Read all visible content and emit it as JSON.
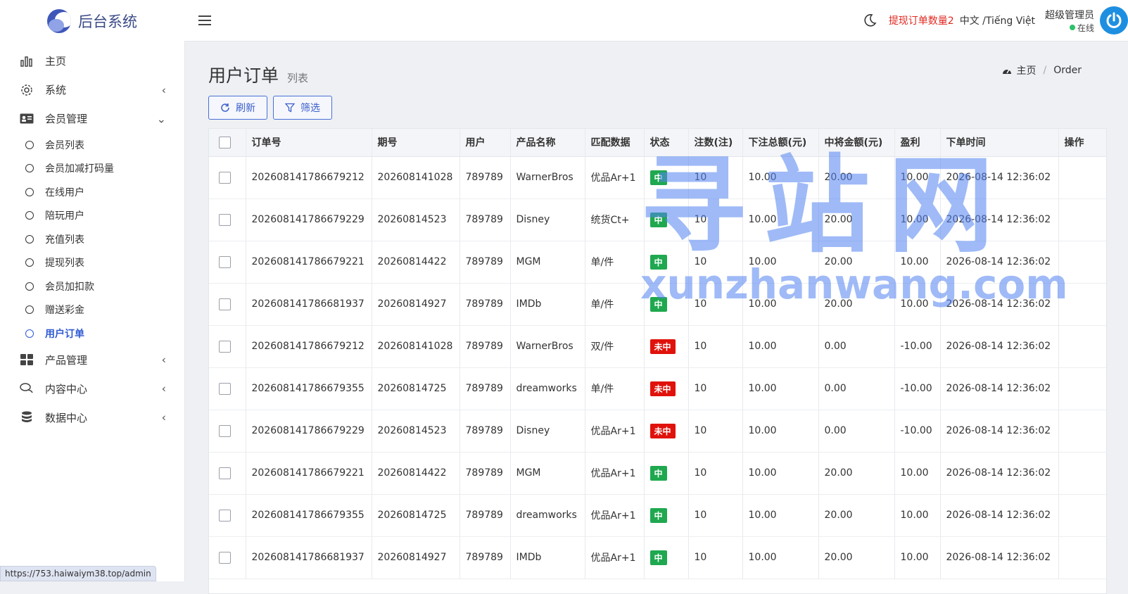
{
  "brand": {
    "name": "后台系统"
  },
  "sidebar": {
    "items": [
      {
        "label": "主页",
        "icon": "bar-chart-icon",
        "caret": ""
      },
      {
        "label": "系统",
        "icon": "gear-icon",
        "caret": "‹"
      },
      {
        "label": "会员管理",
        "icon": "id-card-icon",
        "caret": "⌄"
      }
    ],
    "member_sub": [
      {
        "label": "会员列表",
        "active": false
      },
      {
        "label": "会员加减打码量",
        "active": false
      },
      {
        "label": "在线用户",
        "active": false
      },
      {
        "label": "陪玩用户",
        "active": false
      },
      {
        "label": "充值列表",
        "active": false
      },
      {
        "label": "提现列表",
        "active": false
      },
      {
        "label": "会员加扣款",
        "active": false
      },
      {
        "label": "赠送彩金",
        "active": false
      },
      {
        "label": "用户订单",
        "active": true
      }
    ],
    "items_after": [
      {
        "label": "产品管理",
        "icon": "grid-icon",
        "caret": "‹"
      },
      {
        "label": "内容中心",
        "icon": "chat-icon",
        "caret": "‹"
      },
      {
        "label": "数据中心",
        "icon": "database-icon",
        "caret": "‹"
      }
    ]
  },
  "statusbar": {
    "url": "https://753.haiwaiym38.top/admin"
  },
  "topbar": {
    "withdraw_notice": "提现订单数量2",
    "language": "中文 /Tiếng Việt",
    "user_name": "超级管理员",
    "user_status": "在线"
  },
  "page": {
    "title": "用户订单",
    "subtitle": "列表",
    "breadcrumb_home": "主页",
    "breadcrumb_current": "Order"
  },
  "toolbar": {
    "refresh_label": "刷新",
    "filter_label": "筛选"
  },
  "table": {
    "columns": [
      "订单号",
      "期号",
      "用户",
      "产品名称",
      "匹配数据",
      "状态",
      "注数(注)",
      "下注总额(元)",
      "中将金额(元)",
      "盈利",
      "下单时间",
      "操作"
    ],
    "rows": [
      [
        "202608141786679212",
        "202608141028",
        "789789",
        "WarnerBros",
        "优品Ar+1",
        "中",
        "10",
        "10.00",
        "20.00",
        "10.00",
        "2026-08-14 12:36:02"
      ],
      [
        "202608141786679229",
        "20260814523",
        "789789",
        "Disney",
        "统货Ct+",
        "中",
        "10",
        "10.00",
        "20.00",
        "10.00",
        "2026-08-14 12:36:02"
      ],
      [
        "202608141786679221",
        "20260814422",
        "789789",
        "MGM",
        "单/件",
        "中",
        "10",
        "10.00",
        "20.00",
        "10.00",
        "2026-08-14 12:36:02"
      ],
      [
        "202608141786681937",
        "20260814927",
        "789789",
        "IMDb",
        "单/件",
        "中",
        "10",
        "10.00",
        "20.00",
        "10.00",
        "2026-08-14 12:36:02"
      ],
      [
        "202608141786679212",
        "202608141028",
        "789789",
        "WarnerBros",
        "双/件",
        "未中",
        "10",
        "10.00",
        "0.00",
        "-10.00",
        "2026-08-14 12:36:02"
      ],
      [
        "202608141786679355",
        "20260814725",
        "789789",
        "dreamworks",
        "单/件",
        "未中",
        "10",
        "10.00",
        "0.00",
        "-10.00",
        "2026-08-14 12:36:02"
      ],
      [
        "202608141786679229",
        "20260814523",
        "789789",
        "Disney",
        "优品Ar+1",
        "未中",
        "10",
        "10.00",
        "0.00",
        "-10.00",
        "2026-08-14 12:36:02"
      ],
      [
        "202608141786679221",
        "20260814422",
        "789789",
        "MGM",
        "优品Ar+1",
        "中",
        "10",
        "10.00",
        "20.00",
        "10.00",
        "2026-08-14 12:36:02"
      ],
      [
        "202608141786679355",
        "20260814725",
        "789789",
        "dreamworks",
        "优品Ar+1",
        "中",
        "10",
        "10.00",
        "20.00",
        "10.00",
        "2026-08-14 12:36:02"
      ],
      [
        "202608141786681937",
        "20260814927",
        "789789",
        "IMDb",
        "优品Ar+1",
        "中",
        "10",
        "10.00",
        "20.00",
        "10.00",
        "2026-08-14 12:36:02"
      ]
    ]
  },
  "colors": {
    "win": "#1fa84f",
    "lose": "#e0120b",
    "accent": "#2f5bd3",
    "notice": "#e0281f"
  },
  "watermark": {
    "cn": "寻站网",
    "en": "xunzhanwang.com"
  }
}
